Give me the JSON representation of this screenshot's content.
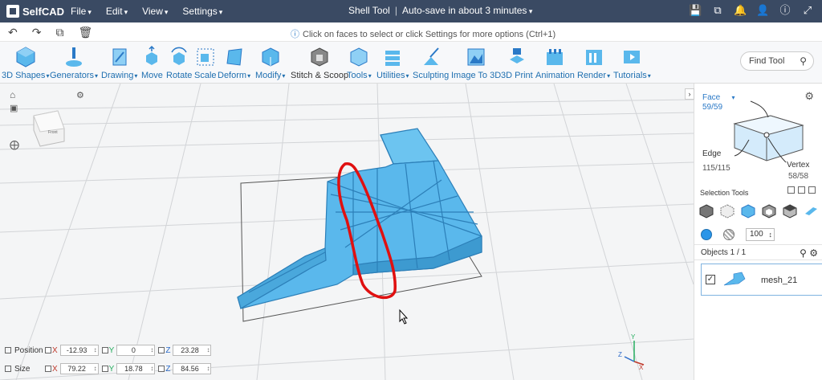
{
  "app": {
    "name": "SelfCAD"
  },
  "menu": [
    "File",
    "Edit",
    "View",
    "Settings"
  ],
  "header": {
    "tool_title": "Shell Tool",
    "autosave": "Auto-save in about 3 minutes"
  },
  "hint": "Click on faces to select or click Settings for more options (Ctrl+1)",
  "toolbar": [
    {
      "label": "3D Shapes",
      "dropdown": true
    },
    {
      "label": "Generators",
      "dropdown": true
    },
    {
      "label": "Drawing",
      "dropdown": true
    },
    {
      "label": "Move",
      "dropdown": false
    },
    {
      "label": "Rotate",
      "dropdown": false
    },
    {
      "label": "Scale",
      "dropdown": false
    },
    {
      "label": "Deform",
      "dropdown": true
    },
    {
      "label": "Modify",
      "dropdown": true
    },
    {
      "label": "Stitch & Scoop",
      "dropdown": false
    },
    {
      "label": "Tools",
      "dropdown": true
    },
    {
      "label": "Utilities",
      "dropdown": true
    },
    {
      "label": "Sculpting",
      "dropdown": false
    },
    {
      "label": "Image To 3D",
      "dropdown": false
    },
    {
      "label": "3D Print",
      "dropdown": false
    },
    {
      "label": "Animation",
      "dropdown": false
    },
    {
      "label": "Render",
      "dropdown": true
    },
    {
      "label": "Tutorials",
      "dropdown": true
    }
  ],
  "find": {
    "placeholder": "Find Tool"
  },
  "cube_label": "Front",
  "transform": {
    "position": {
      "label": "Position",
      "x": "-12.93",
      "y": "0",
      "z": "23.28"
    },
    "size": {
      "label": "Size",
      "x": "79.22",
      "y": "18.78",
      "z": "84.56"
    },
    "axes": {
      "x": "X",
      "y": "Y",
      "z": "Z"
    }
  },
  "panel": {
    "face_label": "Face",
    "face_count": "59/59",
    "edge_label": "Edge",
    "edge_count": "115/115",
    "vertex_label": "Vertex",
    "vertex_count": "58/58",
    "selection_tools": "Selection Tools",
    "brush_size": "100",
    "objects_header": "Objects 1 / 1",
    "object_name": "mesh_21"
  },
  "colors": {
    "topbar": "#3a4a63",
    "accent": "#2a79c7",
    "mesh": "#5ab8ec",
    "annotation": "#e01010"
  }
}
